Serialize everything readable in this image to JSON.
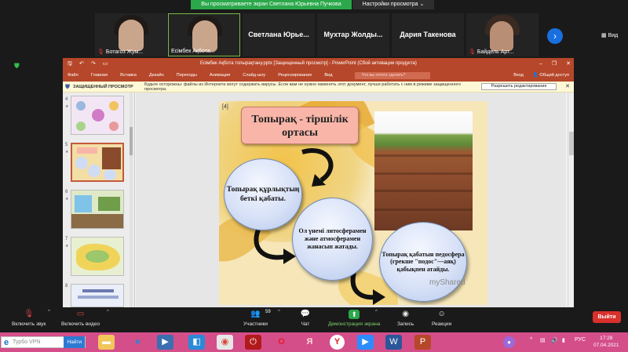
{
  "zoom": {
    "share_banner": "Вы просматриваете экран Светлана Юрьевна Пучкова",
    "view_options": "Настройки просмотра ⌄",
    "view_label": "Вид",
    "participants": [
      {
        "name": "Ботагоз Жум..."
      },
      {
        "name": "Есімбек Ақбота..."
      },
      {
        "name": "Светлана Юрье..."
      },
      {
        "name": "Мухтар Жолды..."
      },
      {
        "name": "Дария Такенова"
      },
      {
        "name": "Байдель Арт..."
      }
    ],
    "controls": {
      "mute": "Включить звук",
      "video": "Включить видео",
      "participants": "Участники",
      "participants_count": "59",
      "chat": "Чат",
      "share": "Демонстрация экрана",
      "record": "Запись",
      "reactions": "Реакции",
      "leave": "Выйти"
    }
  },
  "ppt": {
    "window_title": "Есімбек Ақбота топырақтану.pptx [Защищенный просмотр] - PowerPoint (Сбой активации продукта)",
    "tabs": [
      "Файл",
      "Главная",
      "Вставка",
      "Дизайн",
      "Переходы",
      "Анимация",
      "Слайд-шоу",
      "Рецензирование",
      "Вид"
    ],
    "tell_me": "Что вы хотите сделать?",
    "right_tabs": [
      "Вход",
      "Общий доступ"
    ],
    "protected_label": "ЗАЩИЩЕННЫЙ ПРОСМОТР",
    "protected_text": "Будьте осторожны: файлы из Интернета могут содержать вирусы. Если вам не нужно изменять этот документ, лучше работать с ним в режиме защищенного просмотра.",
    "enable_editing": "Разрешить редактирование",
    "thumb_numbers": [
      "4",
      "5",
      "6",
      "7",
      "8"
    ],
    "slide": {
      "number": "[4]",
      "title": "Топырақ - тіршілік ортасы",
      "bubble1": "Топырақ құрлықтың беткі қабаты.",
      "bubble2": "Ол үнемі литосферамен және атмосферамен жанасып жатады.",
      "bubble3": "Топырақ қабатын педосфера (грекше \"подос\"—аяқ) қабықпен атайды.",
      "watermark": "myShared"
    }
  },
  "taskbar": {
    "vpn": "Турбо VPN",
    "vpn_go": "Найти",
    "lang": "РУС",
    "time": "17:28",
    "date": "07.04.2021"
  }
}
